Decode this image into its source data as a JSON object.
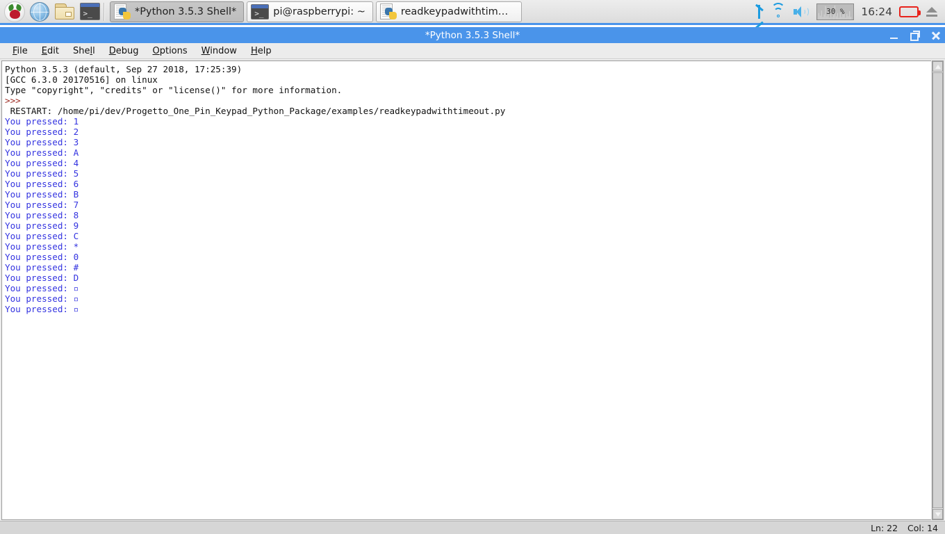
{
  "taskbar": {
    "launchers": [
      {
        "name": "raspberry-menu",
        "icon": "raspberry-icon"
      },
      {
        "name": "web-browser",
        "icon": "globe-icon"
      },
      {
        "name": "file-manager",
        "icon": "folder-icon"
      },
      {
        "name": "terminal",
        "icon": "terminal-icon"
      }
    ],
    "windows": [
      {
        "label": "*Python 3.5.3 Shell*",
        "icon": "python-file-icon",
        "active": true
      },
      {
        "label": "pi@raspberrypi: ~",
        "icon": "terminal-icon",
        "active": false
      },
      {
        "label": "readkeypadwithtimeo…",
        "icon": "python-file-icon",
        "active": false
      }
    ],
    "tray": {
      "bluetooth": "bluetooth-icon",
      "wifi": "wifi-icon",
      "volume": "volume-icon",
      "cpu_percent": "30 %",
      "clock": "16:24",
      "battery": "battery-icon",
      "eject": "eject-icon"
    }
  },
  "window": {
    "title": "*Python 3.5.3 Shell*",
    "buttons": {
      "minimize": "minimize-button",
      "maximize": "maximize-button",
      "close": "close-button"
    },
    "menu": [
      {
        "pre": "",
        "mnemonic": "F",
        "post": "ile"
      },
      {
        "pre": "",
        "mnemonic": "E",
        "post": "dit"
      },
      {
        "pre": "She",
        "mnemonic": "l",
        "post": "l"
      },
      {
        "pre": "",
        "mnemonic": "D",
        "post": "ebug"
      },
      {
        "pre": "",
        "mnemonic": "O",
        "post": "ptions"
      },
      {
        "pre": "",
        "mnemonic": "W",
        "post": "indow"
      },
      {
        "pre": "",
        "mnemonic": "H",
        "post": "elp"
      }
    ]
  },
  "console": {
    "lines": [
      {
        "text": "Python 3.5.3 (default, Sep 27 2018, 17:25:39)",
        "style": "ln-normal"
      },
      {
        "text": "[GCC 6.3.0 20170516] on linux",
        "style": "ln-normal"
      },
      {
        "text": "Type \"copyright\", \"credits\" or \"license()\" for more information.",
        "style": "ln-normal"
      },
      {
        "text": ">>>",
        "style": "ln-prompt"
      },
      {
        "text": " RESTART: /home/pi/dev/Progetto_One_Pin_Keypad_Python_Package/examples/readkeypadwithtimeout.py",
        "style": "ln-restart"
      },
      {
        "text": "You pressed: 1",
        "style": "ln-out"
      },
      {
        "text": "You pressed: 2",
        "style": "ln-out"
      },
      {
        "text": "You pressed: 3",
        "style": "ln-out"
      },
      {
        "text": "You pressed: A",
        "style": "ln-out"
      },
      {
        "text": "You pressed: 4",
        "style": "ln-out"
      },
      {
        "text": "You pressed: 5",
        "style": "ln-out"
      },
      {
        "text": "You pressed: 6",
        "style": "ln-out"
      },
      {
        "text": "You pressed: B",
        "style": "ln-out"
      },
      {
        "text": "You pressed: 7",
        "style": "ln-out"
      },
      {
        "text": "You pressed: 8",
        "style": "ln-out"
      },
      {
        "text": "You pressed: 9",
        "style": "ln-out"
      },
      {
        "text": "You pressed: C",
        "style": "ln-out"
      },
      {
        "text": "You pressed: *",
        "style": "ln-out"
      },
      {
        "text": "You pressed: 0",
        "style": "ln-out"
      },
      {
        "text": "You pressed: #",
        "style": "ln-out"
      },
      {
        "text": "You pressed: D",
        "style": "ln-out"
      },
      {
        "text": "You pressed: ▫",
        "style": "ln-out"
      },
      {
        "text": "You pressed: ▫",
        "style": "ln-out"
      },
      {
        "text": "You pressed: ▫",
        "style": "ln-out"
      }
    ]
  },
  "statusbar": {
    "line": "Ln: 22",
    "col": "Col: 14"
  },
  "colors": {
    "titlebar": "#4a94ea",
    "taskbar": "#e9e9e9",
    "output_text": "#3333e0",
    "prompt_text": "#9c2a22",
    "battery_outline": "#e8231c"
  }
}
